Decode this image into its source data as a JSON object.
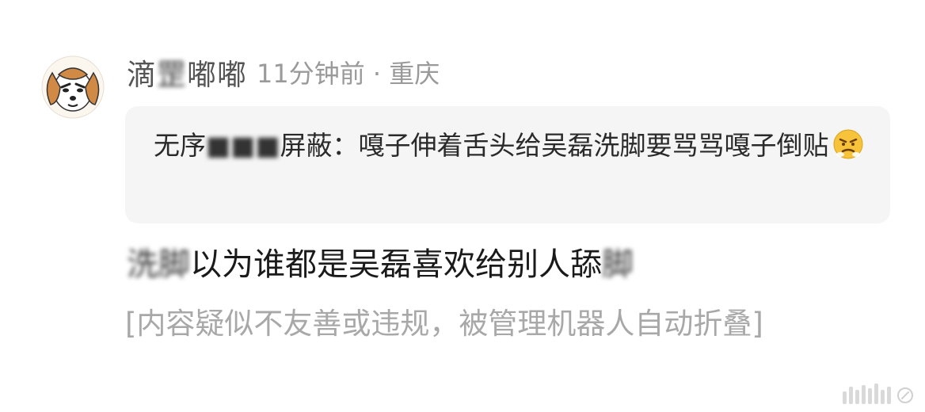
{
  "comment": {
    "username": "滴■■嘟嘟",
    "username_visible_prefix": "滴",
    "username_blurred": "罡",
    "username_visible_suffix": "嘟嘟",
    "meta": "11分钟前 · 重庆",
    "quote": {
      "author_prefix": "无序",
      "author_blurred": "■■■",
      "author_suffix": "屏蔽：",
      "text": "嘎子伸着舌头给吴磊洗脚要骂骂嘎子倒贴"
    },
    "body": {
      "blurred_start": "洗脚",
      "middle": "以为谁都是吴磊喜欢给别人舔",
      "blurred_end": "脚"
    },
    "folded_notice": "[内容疑似不友善或违规，被管理机器人自动折叠]"
  },
  "icons": {
    "avatar": "cartoon-dog-avatar",
    "emoji": "angry-face-emoji",
    "watermark": "weibo-watermark-icon"
  },
  "colors": {
    "username": "#555555",
    "meta": "#9a9a9a",
    "quote_bg": "#f5f5f5",
    "folded": "#a8a8a8",
    "emoji": "#f6c33a"
  }
}
